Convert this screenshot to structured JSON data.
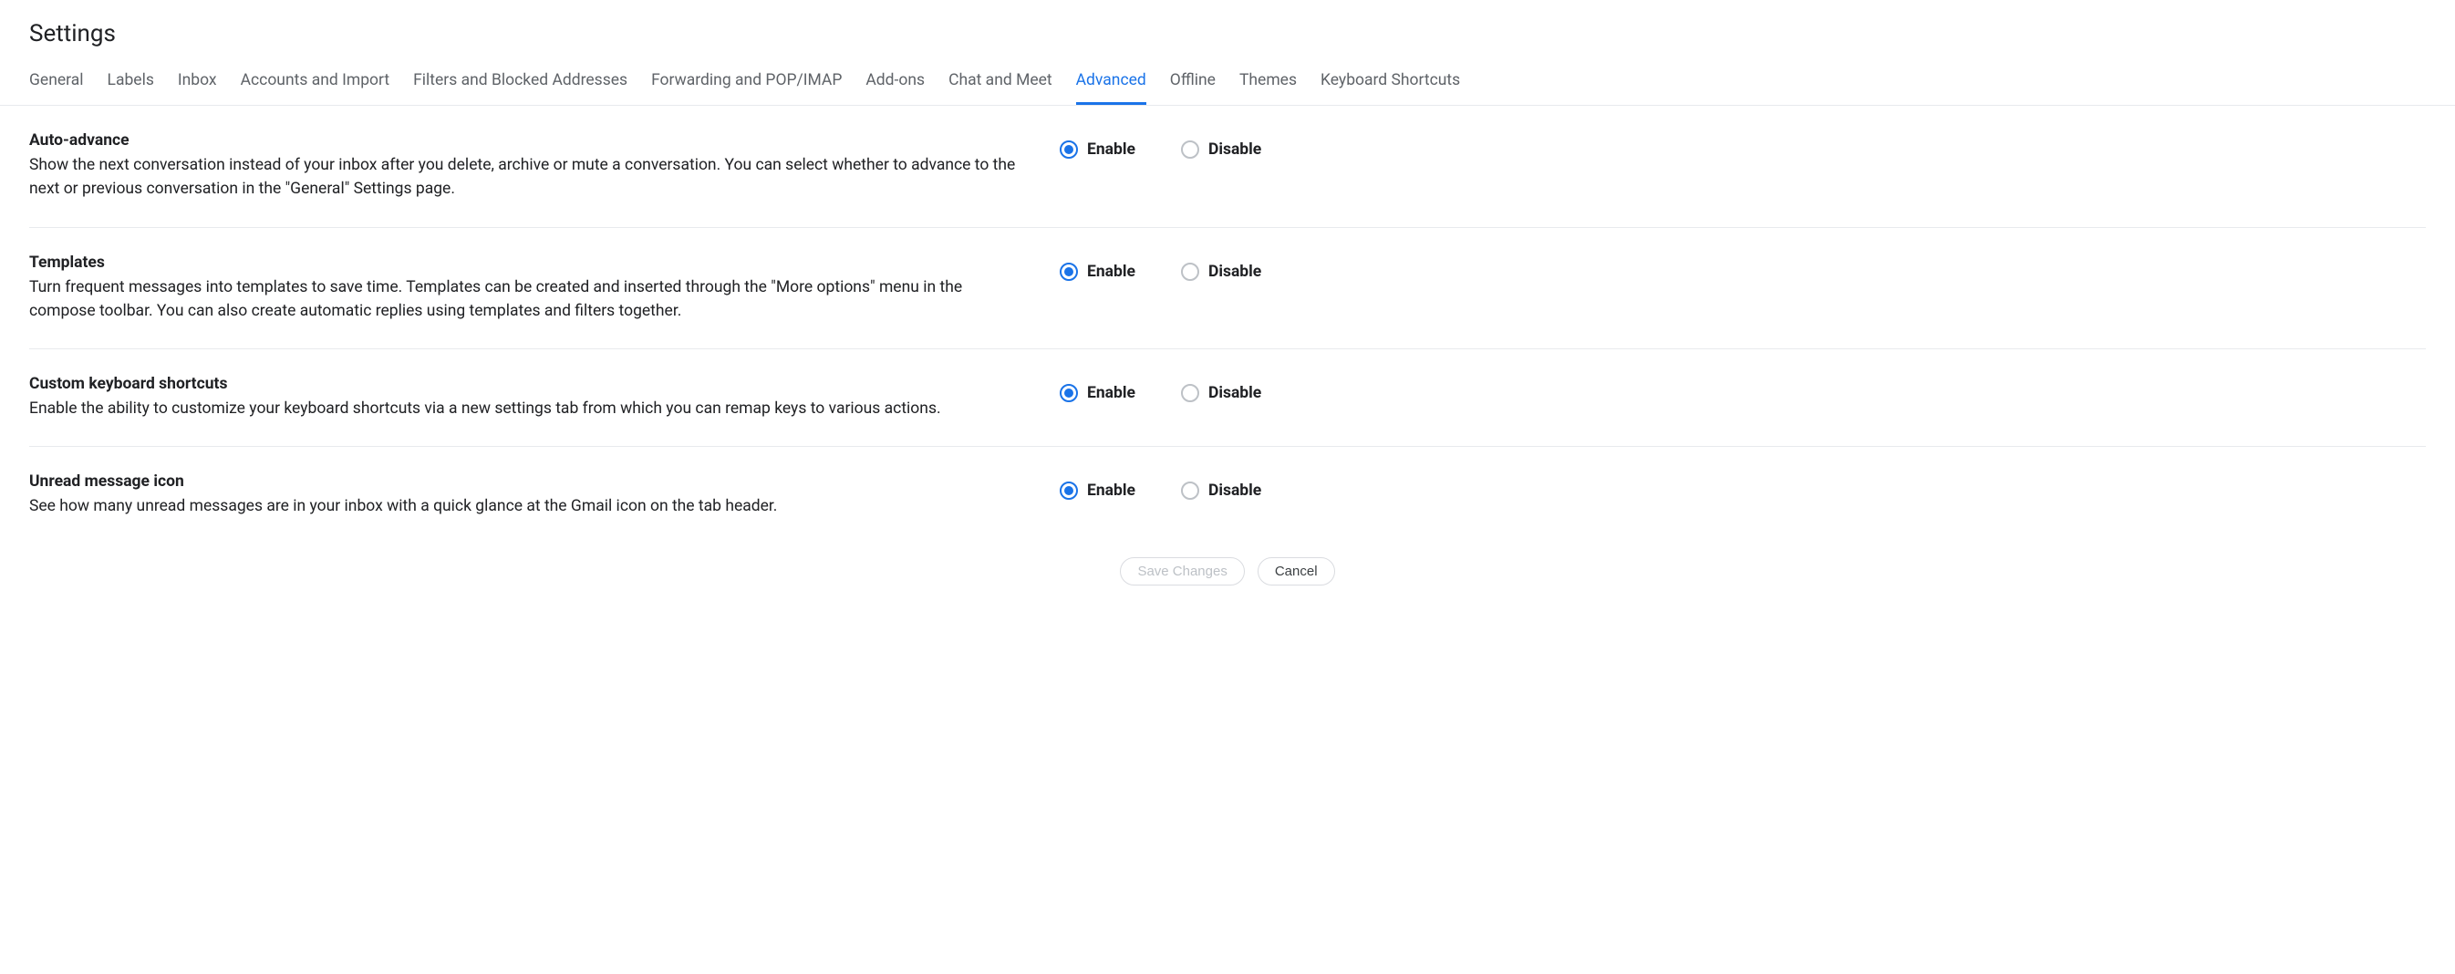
{
  "pageTitle": "Settings",
  "tabs": [
    {
      "id": "general",
      "label": "General",
      "active": false
    },
    {
      "id": "labels",
      "label": "Labels",
      "active": false
    },
    {
      "id": "inbox",
      "label": "Inbox",
      "active": false
    },
    {
      "id": "accounts",
      "label": "Accounts and Import",
      "active": false
    },
    {
      "id": "filters",
      "label": "Filters and Blocked Addresses",
      "active": false
    },
    {
      "id": "forwarding",
      "label": "Forwarding and POP/IMAP",
      "active": false
    },
    {
      "id": "addons",
      "label": "Add-ons",
      "active": false
    },
    {
      "id": "chat",
      "label": "Chat and Meet",
      "active": false
    },
    {
      "id": "advanced",
      "label": "Advanced",
      "active": true
    },
    {
      "id": "offline",
      "label": "Offline",
      "active": false
    },
    {
      "id": "themes",
      "label": "Themes",
      "active": false
    },
    {
      "id": "shortcuts",
      "label": "Keyboard Shortcuts",
      "active": false
    }
  ],
  "options": {
    "enable": "Enable",
    "disable": "Disable"
  },
  "settings": [
    {
      "key": "auto-advance",
      "title": "Auto-advance",
      "desc": "Show the next conversation instead of your inbox after you delete, archive or mute a conversation. You can select whether to advance to the next or previous conversation in the \"General\" Settings page.",
      "value": "enable"
    },
    {
      "key": "templates",
      "title": "Templates",
      "desc": "Turn frequent messages into templates to save time. Templates can be created and inserted through the \"More options\" menu in the compose toolbar. You can also create automatic replies using templates and filters together.",
      "value": "enable"
    },
    {
      "key": "custom-keyboard-shortcuts",
      "title": "Custom keyboard shortcuts",
      "desc": "Enable the ability to customize your keyboard shortcuts via a new settings tab from which you can remap keys to various actions.",
      "value": "enable"
    },
    {
      "key": "unread-message-icon",
      "title": "Unread message icon",
      "desc": "See how many unread messages are in your inbox with a quick glance at the Gmail icon on the tab header.",
      "value": "enable"
    }
  ],
  "actions": {
    "save": "Save Changes",
    "cancel": "Cancel"
  }
}
